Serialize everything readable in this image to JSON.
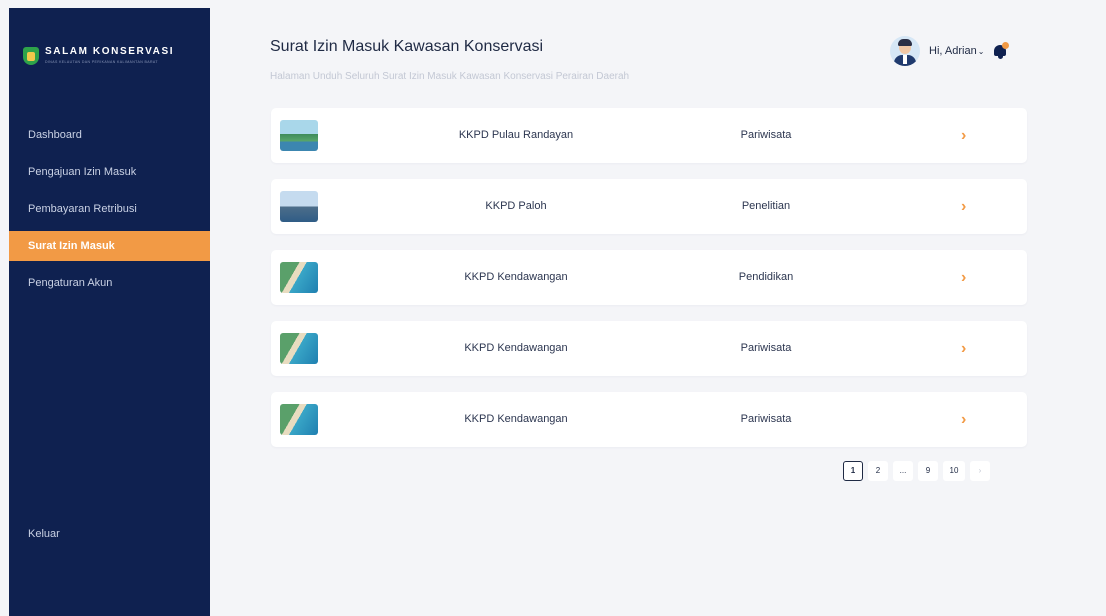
{
  "brand": {
    "title": "SALAM KONSERVASI",
    "subtitle": "DINAS KELAUTAN DAN PERIKANAN KALIMANTAN BARAT"
  },
  "sidebar": {
    "items": [
      {
        "label": "Dashboard"
      },
      {
        "label": "Pengajuan Izin Masuk"
      },
      {
        "label": "Pembayaran Retribusi"
      },
      {
        "label": "Surat Izin Masuk"
      },
      {
        "label": "Pengaturan Akun"
      }
    ],
    "active_index": 3,
    "logout_label": "Keluar"
  },
  "header": {
    "title": "Surat Izin Masuk Kawasan Konservasi",
    "subtitle": "Halaman Unduh Seluruh Surat Izin Masuk Kawasan Konservasi Perairan Daerah",
    "greeting": "Hi, Adrian"
  },
  "permits": [
    {
      "location": "KKPD Pulau Randayan",
      "category": "Pariwisata",
      "thumb": "island-photo"
    },
    {
      "location": "KKPD Paloh",
      "category": "Penelitian",
      "thumb": "bay-photo"
    },
    {
      "location": "KKPD Kendawangan",
      "category": "Pendidikan",
      "thumb": "beach-photo"
    },
    {
      "location": "KKPD Kendawangan",
      "category": "Pariwisata",
      "thumb": "beach-photo"
    },
    {
      "location": "KKPD Kendawangan",
      "category": "Pariwisata",
      "thumb": "beach-photo"
    }
  ],
  "pagination": {
    "pages": [
      "1",
      "2",
      "...",
      "9",
      "10"
    ],
    "current": "1",
    "next_icon": "chevron-right-icon"
  },
  "colors": {
    "sidebar_bg": "#0f2150",
    "accent": "#f29a45",
    "page_bg": "#f4f5f8"
  }
}
